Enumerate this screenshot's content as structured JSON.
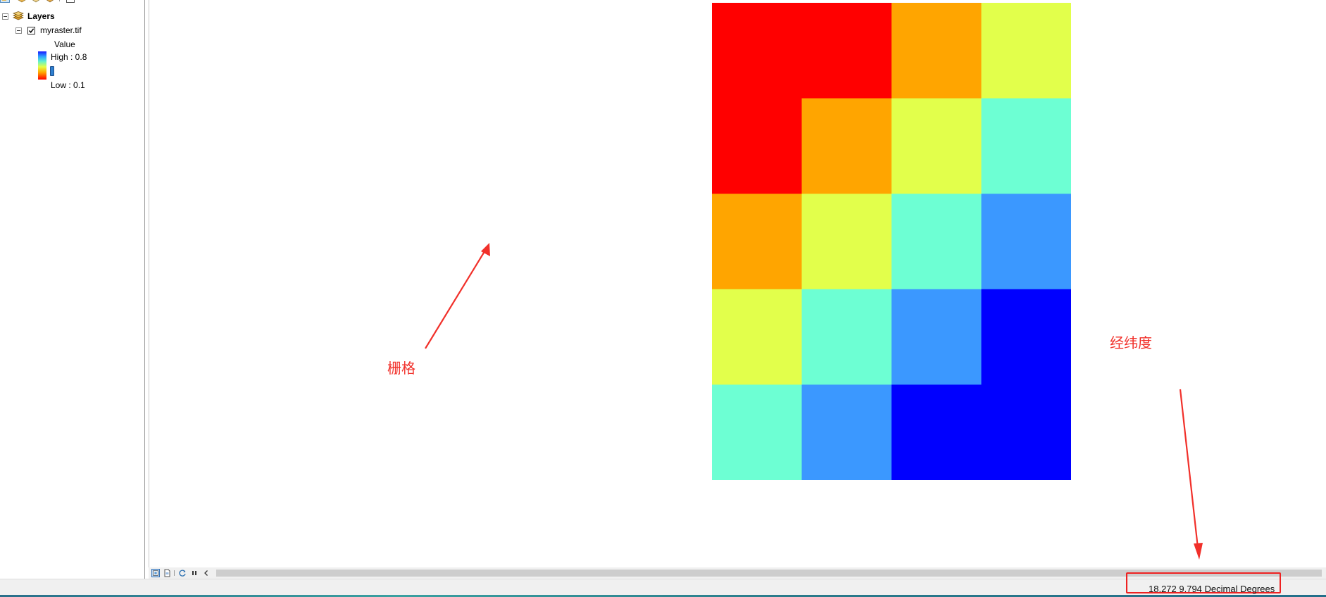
{
  "toc": {
    "root_label": "Layers",
    "layer_name": "myraster.tif",
    "layer_checked": true,
    "legend": {
      "field": "Value",
      "high_label": "High : 0.8",
      "low_label": "Low : 0.1"
    }
  },
  "icons": {
    "toc_toolbar": [
      "list-by-drawing-order-icon",
      "list-by-source-icon",
      "list-by-visibility-icon",
      "list-by-selection-icon",
      "options-icon"
    ],
    "layers": "layers-icon",
    "view_bar": [
      "data-view-icon",
      "layout-view-icon",
      "refresh-icon",
      "pause-drawing-icon",
      "scroll-left-icon"
    ]
  },
  "raster": {
    "rows": 5,
    "cols": 4,
    "cells": [
      [
        "#ff0000",
        "#ff0000",
        "#ffa500",
        "#e2ff4b"
      ],
      [
        "#ff0000",
        "#ffa500",
        "#e2ff4b",
        "#6dffd3"
      ],
      [
        "#ffa500",
        "#e2ff4b",
        "#6dffd3",
        "#3b98ff"
      ],
      [
        "#e2ff4b",
        "#6dffd3",
        "#3b98ff",
        "#0000ff"
      ],
      [
        "#6dffd3",
        "#3b98ff",
        "#0000ff",
        "#0000ff"
      ]
    ]
  },
  "annotations": {
    "raster_label": "栅格",
    "coord_label": "经纬度",
    "color": "#f1302a"
  },
  "status": {
    "coordinates": "18.272  9.794 Decimal Degrees"
  }
}
